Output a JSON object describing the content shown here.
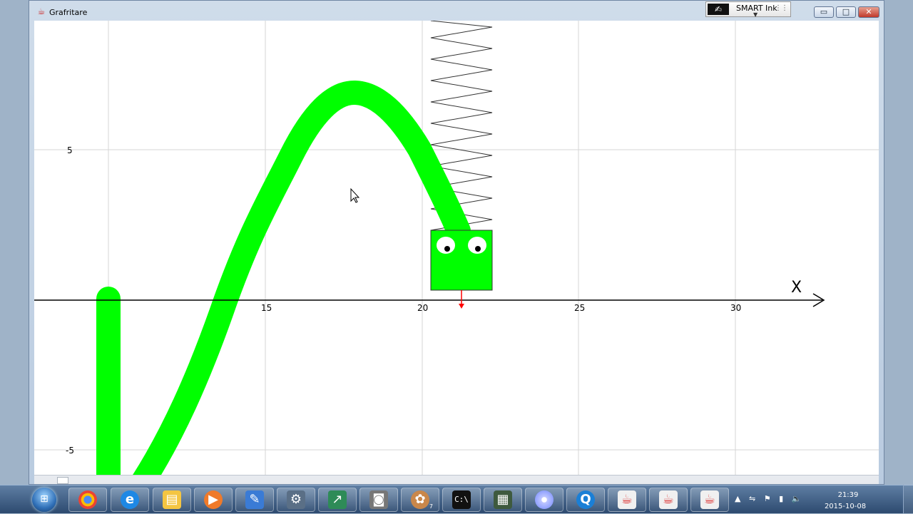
{
  "window": {
    "title": "Grafritare",
    "smart_ink_label": "SMART Ink",
    "buttons": {
      "minimize": "▭",
      "maximize": "□",
      "close": "✕"
    }
  },
  "graph": {
    "axis_label_x": "X",
    "x_ticks": [
      "15",
      "20",
      "25",
      "30"
    ],
    "y_ticks": [
      "5",
      "-5"
    ],
    "colors": {
      "curve": "#00ff00",
      "grid": "#d6d6d6",
      "axis": "#000000",
      "arrow": "#ff0000"
    }
  },
  "taskbar": {
    "start_icon": "windows-start-orb",
    "apps": [
      {
        "icon": "chrome-icon",
        "badge": ""
      },
      {
        "icon": "internet-explorer-icon",
        "badge": ""
      },
      {
        "icon": "file-explorer-icon",
        "badge": ""
      },
      {
        "icon": "media-player-icon",
        "badge": ""
      },
      {
        "icon": "notepad-icon",
        "badge": ""
      },
      {
        "icon": "robot-icon",
        "badge": ""
      },
      {
        "icon": "chart-app-icon",
        "badge": ""
      },
      {
        "icon": "camera-icon",
        "badge": ""
      },
      {
        "icon": "paint-icon",
        "badge": "7"
      },
      {
        "icon": "command-prompt-icon",
        "badge": ""
      },
      {
        "icon": "calculator-icon",
        "badge": ""
      },
      {
        "icon": "disc-icon",
        "badge": ""
      },
      {
        "icon": "quicktime-icon",
        "badge": ""
      },
      {
        "icon": "java-icon",
        "badge": ""
      },
      {
        "icon": "java-icon",
        "badge": ""
      },
      {
        "icon": "java-icon",
        "badge": ""
      }
    ],
    "clock_time": "21:39",
    "clock_date": "2015-10-08"
  }
}
